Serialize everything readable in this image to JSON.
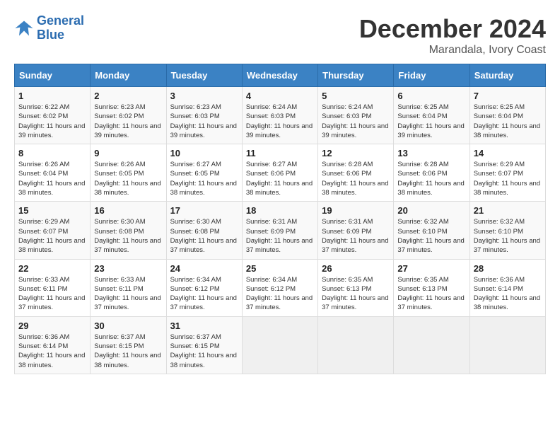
{
  "header": {
    "logo_line1": "General",
    "logo_line2": "Blue",
    "title": "December 2024",
    "subtitle": "Marandala, Ivory Coast"
  },
  "days_of_week": [
    "Sunday",
    "Monday",
    "Tuesday",
    "Wednesday",
    "Thursday",
    "Friday",
    "Saturday"
  ],
  "weeks": [
    [
      {
        "day": "1",
        "sunrise": "6:22 AM",
        "sunset": "6:02 PM",
        "daylight": "11 hours and 39 minutes."
      },
      {
        "day": "2",
        "sunrise": "6:23 AM",
        "sunset": "6:02 PM",
        "daylight": "11 hours and 39 minutes."
      },
      {
        "day": "3",
        "sunrise": "6:23 AM",
        "sunset": "6:03 PM",
        "daylight": "11 hours and 39 minutes."
      },
      {
        "day": "4",
        "sunrise": "6:24 AM",
        "sunset": "6:03 PM",
        "daylight": "11 hours and 39 minutes."
      },
      {
        "day": "5",
        "sunrise": "6:24 AM",
        "sunset": "6:03 PM",
        "daylight": "11 hours and 39 minutes."
      },
      {
        "day": "6",
        "sunrise": "6:25 AM",
        "sunset": "6:04 PM",
        "daylight": "11 hours and 39 minutes."
      },
      {
        "day": "7",
        "sunrise": "6:25 AM",
        "sunset": "6:04 PM",
        "daylight": "11 hours and 38 minutes."
      }
    ],
    [
      {
        "day": "8",
        "sunrise": "6:26 AM",
        "sunset": "6:04 PM",
        "daylight": "11 hours and 38 minutes."
      },
      {
        "day": "9",
        "sunrise": "6:26 AM",
        "sunset": "6:05 PM",
        "daylight": "11 hours and 38 minutes."
      },
      {
        "day": "10",
        "sunrise": "6:27 AM",
        "sunset": "6:05 PM",
        "daylight": "11 hours and 38 minutes."
      },
      {
        "day": "11",
        "sunrise": "6:27 AM",
        "sunset": "6:06 PM",
        "daylight": "11 hours and 38 minutes."
      },
      {
        "day": "12",
        "sunrise": "6:28 AM",
        "sunset": "6:06 PM",
        "daylight": "11 hours and 38 minutes."
      },
      {
        "day": "13",
        "sunrise": "6:28 AM",
        "sunset": "6:06 PM",
        "daylight": "11 hours and 38 minutes."
      },
      {
        "day": "14",
        "sunrise": "6:29 AM",
        "sunset": "6:07 PM",
        "daylight": "11 hours and 38 minutes."
      }
    ],
    [
      {
        "day": "15",
        "sunrise": "6:29 AM",
        "sunset": "6:07 PM",
        "daylight": "11 hours and 38 minutes."
      },
      {
        "day": "16",
        "sunrise": "6:30 AM",
        "sunset": "6:08 PM",
        "daylight": "11 hours and 37 minutes."
      },
      {
        "day": "17",
        "sunrise": "6:30 AM",
        "sunset": "6:08 PM",
        "daylight": "11 hours and 37 minutes."
      },
      {
        "day": "18",
        "sunrise": "6:31 AM",
        "sunset": "6:09 PM",
        "daylight": "11 hours and 37 minutes."
      },
      {
        "day": "19",
        "sunrise": "6:31 AM",
        "sunset": "6:09 PM",
        "daylight": "11 hours and 37 minutes."
      },
      {
        "day": "20",
        "sunrise": "6:32 AM",
        "sunset": "6:10 PM",
        "daylight": "11 hours and 37 minutes."
      },
      {
        "day": "21",
        "sunrise": "6:32 AM",
        "sunset": "6:10 PM",
        "daylight": "11 hours and 37 minutes."
      }
    ],
    [
      {
        "day": "22",
        "sunrise": "6:33 AM",
        "sunset": "6:11 PM",
        "daylight": "11 hours and 37 minutes."
      },
      {
        "day": "23",
        "sunrise": "6:33 AM",
        "sunset": "6:11 PM",
        "daylight": "11 hours and 37 minutes."
      },
      {
        "day": "24",
        "sunrise": "6:34 AM",
        "sunset": "6:12 PM",
        "daylight": "11 hours and 37 minutes."
      },
      {
        "day": "25",
        "sunrise": "6:34 AM",
        "sunset": "6:12 PM",
        "daylight": "11 hours and 37 minutes."
      },
      {
        "day": "26",
        "sunrise": "6:35 AM",
        "sunset": "6:13 PM",
        "daylight": "11 hours and 37 minutes."
      },
      {
        "day": "27",
        "sunrise": "6:35 AM",
        "sunset": "6:13 PM",
        "daylight": "11 hours and 37 minutes."
      },
      {
        "day": "28",
        "sunrise": "6:36 AM",
        "sunset": "6:14 PM",
        "daylight": "11 hours and 38 minutes."
      }
    ],
    [
      {
        "day": "29",
        "sunrise": "6:36 AM",
        "sunset": "6:14 PM",
        "daylight": "11 hours and 38 minutes."
      },
      {
        "day": "30",
        "sunrise": "6:37 AM",
        "sunset": "6:15 PM",
        "daylight": "11 hours and 38 minutes."
      },
      {
        "day": "31",
        "sunrise": "6:37 AM",
        "sunset": "6:15 PM",
        "daylight": "11 hours and 38 minutes."
      },
      null,
      null,
      null,
      null
    ]
  ]
}
